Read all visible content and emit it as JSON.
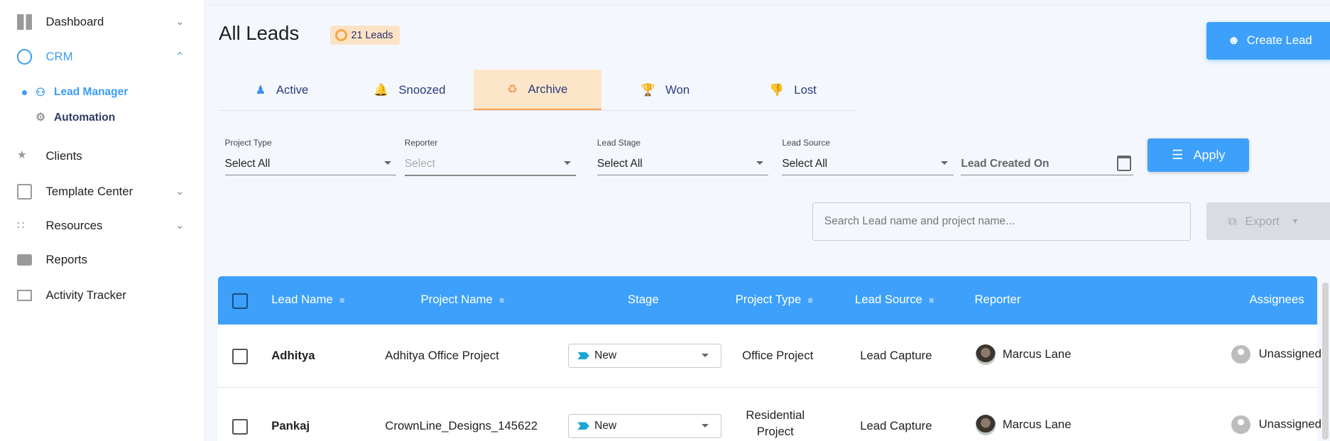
{
  "sidebar": {
    "items": [
      {
        "label": "Dashboard",
        "icon": "dashboard-icon"
      },
      {
        "label": "CRM",
        "icon": "crm-icon"
      },
      {
        "label": "Lead Manager",
        "icon": "lead-manager-icon"
      },
      {
        "label": "Automation",
        "icon": "automation-icon"
      },
      {
        "label": "Clients",
        "icon": "clients-icon"
      },
      {
        "label": "Template Center",
        "icon": "template-icon"
      },
      {
        "label": "Resources",
        "icon": "resources-icon"
      },
      {
        "label": "Reports",
        "icon": "reports-icon"
      },
      {
        "label": "Activity Tracker",
        "icon": "activity-icon"
      }
    ]
  },
  "header": {
    "title": "All Leads",
    "badge": "21 Leads",
    "create_label": "Create Lead"
  },
  "tabs": [
    {
      "label": "Active"
    },
    {
      "label": "Snoozed"
    },
    {
      "label": "Archive"
    },
    {
      "label": "Won"
    },
    {
      "label": "Lost"
    }
  ],
  "filters": {
    "project_type": {
      "label": "Project Type",
      "value": "Select All"
    },
    "reporter": {
      "label": "Reporter",
      "placeholder": "Select"
    },
    "lead_stage": {
      "label": "Lead Stage",
      "value": "Select All"
    },
    "lead_source": {
      "label": "Lead Source",
      "value": "Select All"
    },
    "created_on": {
      "placeholder": "Lead Created On"
    },
    "apply_label": "Apply"
  },
  "search": {
    "placeholder": "Search Lead name and project name..."
  },
  "export_label": "Export",
  "table": {
    "columns": [
      "Lead Name",
      "Project Name",
      "Stage",
      "Project Type",
      "Lead Source",
      "Reporter",
      "Assignees"
    ],
    "rows": [
      {
        "lead": "Adhitya",
        "project": "Adhitya Office Project",
        "stage": "New",
        "type": "Office Project",
        "source": "Lead Capture",
        "reporter": "Marcus Lane",
        "assignee": "Unassigned"
      },
      {
        "lead": "Pankaj",
        "project": "CrownLine_Designs_145622",
        "stage": "New",
        "type": "Residential Project",
        "source": "Lead Capture",
        "reporter": "Marcus Lane",
        "assignee": "Unassigned"
      }
    ]
  },
  "colors": {
    "accent": "#3da0fb",
    "active_tab_bg": "#fde5c9",
    "badge_bg": "#fde3c6"
  }
}
